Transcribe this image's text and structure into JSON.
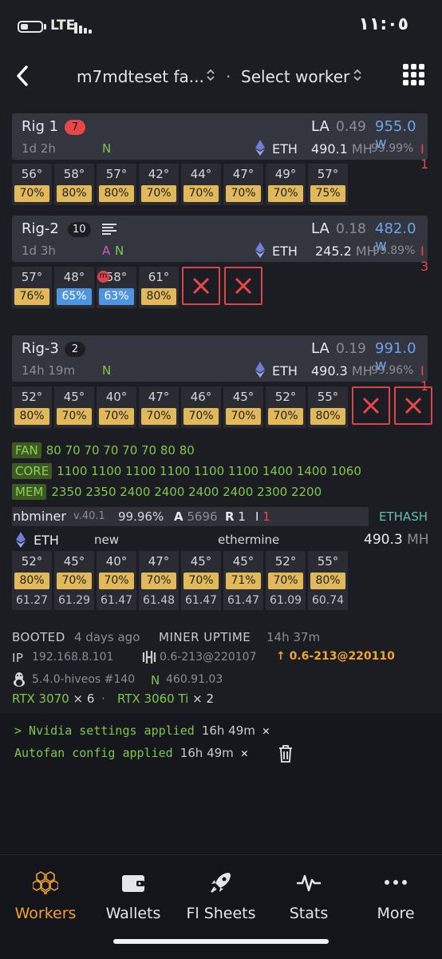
{
  "status_bar": {
    "network": "LTE",
    "time": "١١:٠٥"
  },
  "header": {
    "farm": "m7mdteset fa...",
    "separator": "·",
    "worker_select": "Select worker"
  },
  "rigs": [
    {
      "name": "Rig 1",
      "badge": "7",
      "uptime": "1d 2h",
      "flags_a": "",
      "flags_n": "N",
      "la_label": "LA",
      "la": "0.49",
      "power": "955.0 w",
      "coin": "ETH",
      "hashrate": "490.1",
      "unit": "MH",
      "accepted": "99.99%",
      "errors": "I 1",
      "gpus": [
        {
          "temp": "56°",
          "fan": "70%"
        },
        {
          "temp": "58°",
          "fan": "80%"
        },
        {
          "temp": "57°",
          "fan": "80%"
        },
        {
          "temp": "42°",
          "fan": "70%"
        },
        {
          "temp": "44°",
          "fan": "70%"
        },
        {
          "temp": "47°",
          "fan": "70%"
        },
        {
          "temp": "49°",
          "fan": "70%"
        },
        {
          "temp": "57°",
          "fan": "75%"
        }
      ]
    },
    {
      "name": "Rig-2",
      "badge": "10",
      "uptime": "1d 3h",
      "flags_a": "A",
      "flags_n": "N",
      "la_label": "LA",
      "la": "0.18",
      "power": "482.0 w",
      "coin": "ETH",
      "hashrate": "245.2",
      "unit": "MH",
      "accepted": "99.89%",
      "errors": "I 3",
      "gpus": [
        {
          "temp": "57°",
          "fan": "76%"
        },
        {
          "temp": "48°",
          "fan": "65%"
        },
        {
          "temp": "58°",
          "fan": "63%",
          "mark": "m"
        },
        {
          "temp": "61°",
          "fan": "80%"
        }
      ]
    },
    {
      "name": "Rig-3",
      "badge": "2",
      "uptime": "14h 19m",
      "flags_a": "",
      "flags_n": "N",
      "la_label": "LA",
      "la": "0.19",
      "power": "991.0 w",
      "coin": "ETH",
      "hashrate": "490.3",
      "unit": "MH",
      "accepted": "99.96%",
      "errors": "I 1",
      "gpus": [
        {
          "temp": "52°",
          "fan": "80%"
        },
        {
          "temp": "45°",
          "fan": "70%"
        },
        {
          "temp": "40°",
          "fan": "70%"
        },
        {
          "temp": "47°",
          "fan": "70%"
        },
        {
          "temp": "46°",
          "fan": "70%"
        },
        {
          "temp": "45°",
          "fan": "70%"
        },
        {
          "temp": "52°",
          "fan": "70%"
        },
        {
          "temp": "55°",
          "fan": "80%"
        }
      ]
    }
  ],
  "tuning": {
    "fan_label": "FAN",
    "fan": "80 70 70 70 70 70 80 80",
    "core_label": "CORE",
    "core": "1100 1100 1100 1100 1100 1100 1400 1400 1060",
    "mem_label": "MEM",
    "mem": "2350 2350 2400 2400 2400 2400 2300 2200"
  },
  "miner": {
    "name": "nbminer",
    "version": "v.40.1",
    "accepted": "99.96%",
    "a_label": "A",
    "a": "5696",
    "r_label": "R",
    "r": "1",
    "i_label": "I",
    "i": "1",
    "algo": "ETHASH",
    "coin": "ETH",
    "wallet": "new",
    "pool": "ethermine",
    "hashrate": "490.3",
    "unit": "MH",
    "gpus": [
      {
        "temp": "52°",
        "fan": "80%",
        "hash": "61.27"
      },
      {
        "temp": "45°",
        "fan": "70%",
        "hash": "61.29"
      },
      {
        "temp": "40°",
        "fan": "70%",
        "hash": "61.47"
      },
      {
        "temp": "47°",
        "fan": "70%",
        "hash": "61.48"
      },
      {
        "temp": "45°",
        "fan": "70%",
        "hash": "61.47"
      },
      {
        "temp": "45°",
        "fan": "71%",
        "hash": "61.47"
      },
      {
        "temp": "52°",
        "fan": "70%",
        "hash": "61.09"
      },
      {
        "temp": "55°",
        "fan": "80%",
        "hash": "60.74"
      }
    ]
  },
  "info": {
    "booted_label": "BOOTED",
    "booted": "4 days ago",
    "uptime_label": "MINER UPTIME",
    "uptime": "14h 37m",
    "ip_label": "IP",
    "ip": "192.168.8.101",
    "hive_version": "0.6-213@220107",
    "update_version": "0.6-213@220110",
    "kernel": "5.4.0-hiveos #140",
    "nvidia_label": "N",
    "nvidia": "460.91.03",
    "gpu1": "RTX 3070",
    "gpu1_count": "× 6",
    "gpu_sep": "·",
    "gpu2": "RTX 3060 Ti",
    "gpu2_count": "× 2"
  },
  "logs": [
    {
      "text": "> Nvidia settings applied",
      "ago": "16h 49m"
    },
    {
      "text": "Autofan config applied",
      "ago": "16h 49m"
    }
  ],
  "tabs": [
    {
      "label": "Workers",
      "icon": "workers-hex-icon",
      "active": true
    },
    {
      "label": "Wallets",
      "icon": "wallet-icon"
    },
    {
      "label": "Fl Sheets",
      "icon": "rocket-icon"
    },
    {
      "label": "Stats",
      "icon": "pulse-icon"
    },
    {
      "label": "More",
      "icon": "more-dots-icon"
    }
  ],
  "colors": {
    "accent": "#f0a331",
    "green": "#7fc74a",
    "red": "#e9464a",
    "blue": "#6ea3ec",
    "fan": "#e1b95a"
  }
}
